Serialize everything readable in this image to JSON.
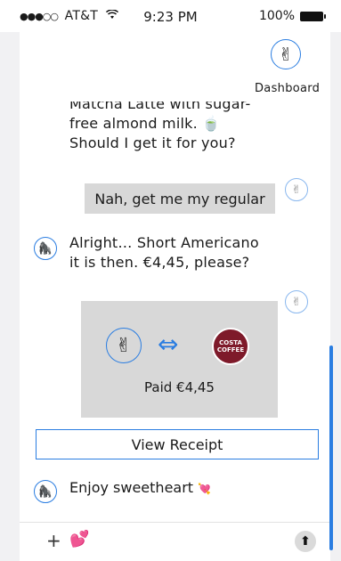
{
  "status_bar": {
    "signal_dots": "●●●○○",
    "carrier": "AT&T",
    "wifi_icon": "wifi-icon",
    "time": "9:23 PM",
    "battery_text": "100%"
  },
  "header": {
    "avatar_icon": "peace-hand-icon",
    "dashboard_label": "Dashboard"
  },
  "chat": {
    "bot_message_1_line1": "Matcha Latte with sugar-",
    "bot_message_1_line2": "free almond milk. 🍵",
    "bot_message_1_line3": "Should I get it for you?",
    "user_message_1": "Nah, get me my regular",
    "bot_message_2_line1": "Alright… Short Americano",
    "bot_message_2_line2": "it is then. €4,45, please?",
    "payment": {
      "user_icon": "peace-hand-icon",
      "arrow_icon": "⇔",
      "merchant_logo_text": "COSTA COFFEE",
      "paid_text": "Paid €4,45"
    },
    "view_receipt_label": "View Receipt",
    "bot_message_3": "Enjoy sweetheart",
    "bot_message_3_emoji": "💘"
  },
  "bottom_bar": {
    "plus_label": "+",
    "hearts_icon": "💕",
    "send_icon": "🡅"
  },
  "colors": {
    "accent": "#2a7de1",
    "bubble_gray": "#d8d8d8",
    "costa_red": "#7e1a2a"
  }
}
